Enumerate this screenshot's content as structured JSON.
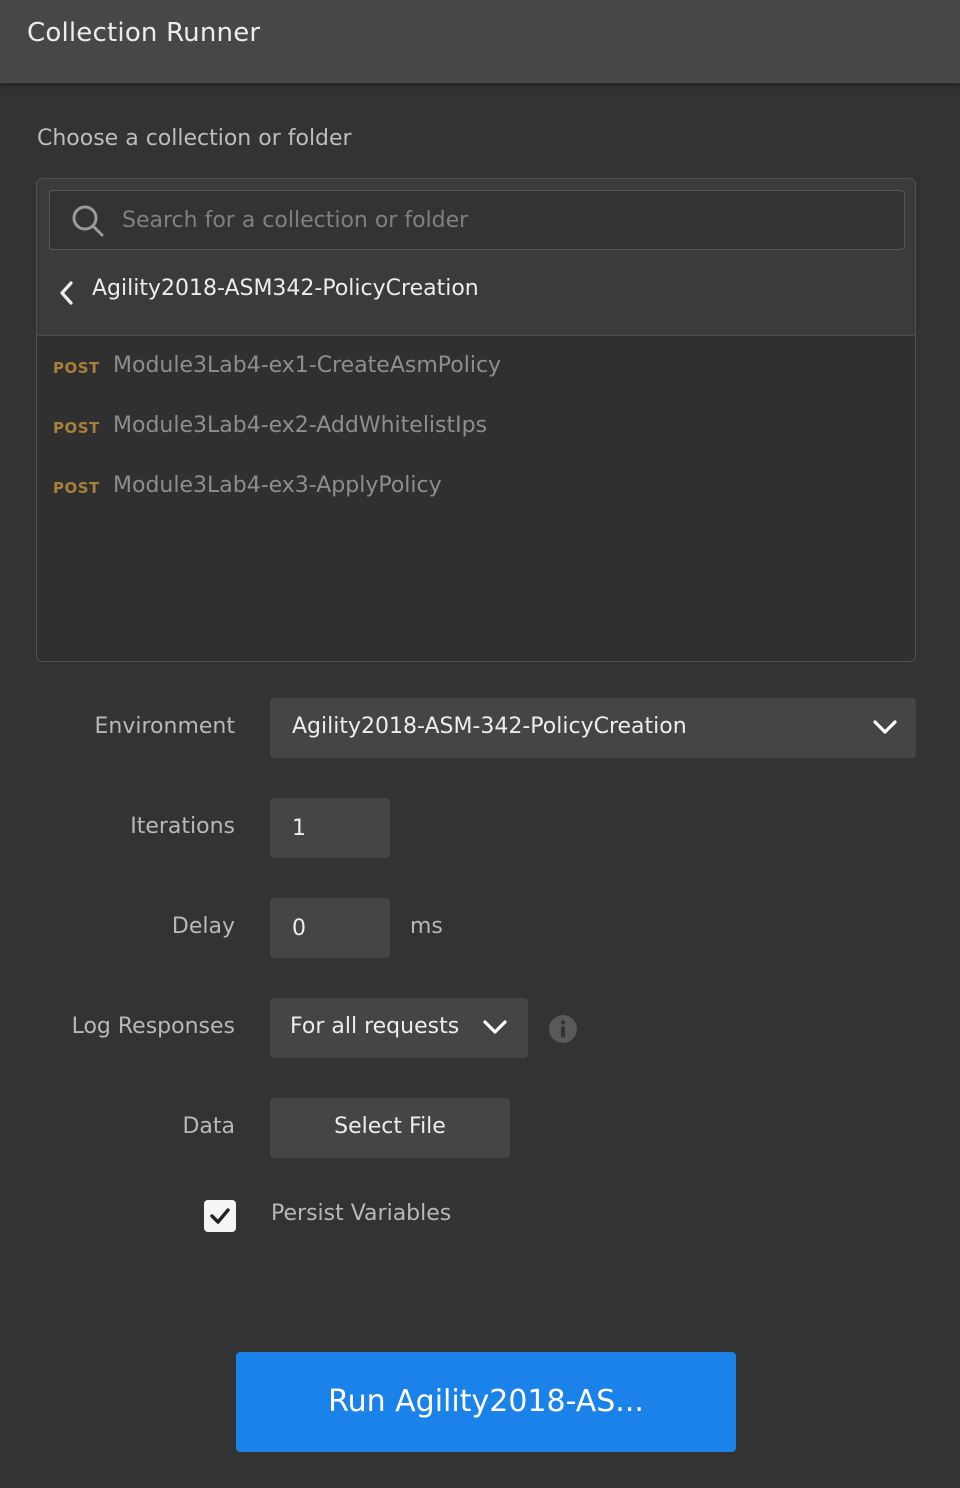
{
  "header": {
    "title": "Collection Runner"
  },
  "chooser": {
    "label": "Choose a collection or folder",
    "search_placeholder": "Search for a collection or folder",
    "search_value": "",
    "breadcrumb": "Agility2018-ASM342-PolicyCreation",
    "requests": [
      {
        "method": "POST",
        "name": "Module3Lab4-ex1-CreateAsmPolicy"
      },
      {
        "method": "POST",
        "name": "Module3Lab4-ex2-AddWhitelistIps"
      },
      {
        "method": "POST",
        "name": "Module3Lab4-ex3-ApplyPolicy"
      }
    ]
  },
  "form": {
    "environment_label": "Environment",
    "environment_value": "Agility2018-ASM-342-PolicyCreation",
    "iterations_label": "Iterations",
    "iterations_value": "1",
    "delay_label": "Delay",
    "delay_value": "0",
    "delay_unit": "ms",
    "log_label": "Log Responses",
    "log_value": "For all requests",
    "data_label": "Data",
    "select_file_label": "Select File",
    "persist_label": "Persist Variables",
    "persist_checked": true
  },
  "run_button": {
    "label": "Run Agility2018-AS..."
  },
  "colors": {
    "background": "#333333",
    "header": "#474747",
    "method_post": "#a7813a",
    "primary": "#1a82e8"
  },
  "icons": [
    "search-icon",
    "chevron-left-icon",
    "chevron-down-icon",
    "info-icon",
    "checkmark-icon"
  ]
}
